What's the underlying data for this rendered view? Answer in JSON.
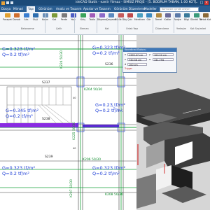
{
  "window": {
    "title": "ideCAD Statik - ezeiir Yilmaz - SIMSIZ PROJE - [5. BODRUM TABAN, 1.00 KOT]",
    "minimize": "–",
    "maximize": "□",
    "close": "×"
  },
  "menu": {
    "tabs": [
      "Dosya",
      "Mimari",
      "Yapı",
      "Görünüm",
      "Analiz ve Tasarım",
      "Ayarlar ve Tasarım",
      "Görünüm Düzenleme",
      "Modeller"
    ],
    "search_placeholder": "Komutlar içinde arayın"
  },
  "ribbon": {
    "buttons": [
      "Parapet",
      "Aks",
      "Kolon",
      "Perde",
      "Kiriş",
      "Döşeme",
      "Bütük Döşeme",
      "Merdiven",
      "Temel",
      "Radye",
      "Sürekli Temel",
      "Donatı",
      "Ölçü",
      "Kot",
      "Yazı",
      "Tablo",
      "Çerçeve",
      "Çatı",
      "Gör",
      "Katlar",
      "Bilgi",
      "Ortak Kat"
    ],
    "groups": [
      "Betonarme",
      "Çelik",
      "Eleman",
      "Kat",
      "Ortak Yapı",
      "Düzenleme",
      "Yerleşim",
      "Kat Seçimleri"
    ]
  },
  "drawing": {
    "load_labels": [
      {
        "g": "G=0.323 tf/m²",
        "q": "Q=0.2 tf/m²"
      },
      {
        "g": "G=0.323 tf/m²",
        "q": "Q=0.2 tf/m²"
      },
      {
        "g": "G=0.345 tf/m²",
        "q": "Q=0.2 tf/m²"
      },
      {
        "g": "G=0.23 tf/m²",
        "q": "Q=0.2 tf/m²"
      },
      {
        "g": "G=0.323 tf/m²",
        "q": "Q=0.2 tf/m²"
      },
      {
        "g": "G=0.323 tf/m²",
        "q": "Q=0.2 tf/m²"
      }
    ],
    "beam_labels": [
      "K224 50/30",
      "KZ04 50/30",
      "K225 50/30",
      "K206 50/30",
      "K207 50/30",
      "K208 50/30"
    ],
    "slab_labels": [
      "S237",
      "S238",
      "S239",
      "S236"
    ],
    "small_labels": [
      "40",
      "40"
    ]
  },
  "dialog": {
    "title": "Koordinat Bulucu",
    "rows": [
      {
        "label": "x",
        "value": "1399.07 cm",
        "label2": "y",
        "value2": "100.50 cm"
      },
      {
        "label": "z",
        "value": "730.36 cm",
        "label2": "a",
        "value2": "131.794"
      },
      {
        "label": "d",
        "value": "100 cm",
        "label2": "",
        "value2": ""
      }
    ],
    "header_line": "Trigger"
  },
  "colors": {
    "titlebar": "#1b4a78",
    "menubar": "#2b5f93",
    "load_text": "#1f3fd6",
    "beam_text": "#0c8a2a",
    "slab_highlight": "#8a2be2",
    "view3d_bg": "#d6d6d6"
  }
}
